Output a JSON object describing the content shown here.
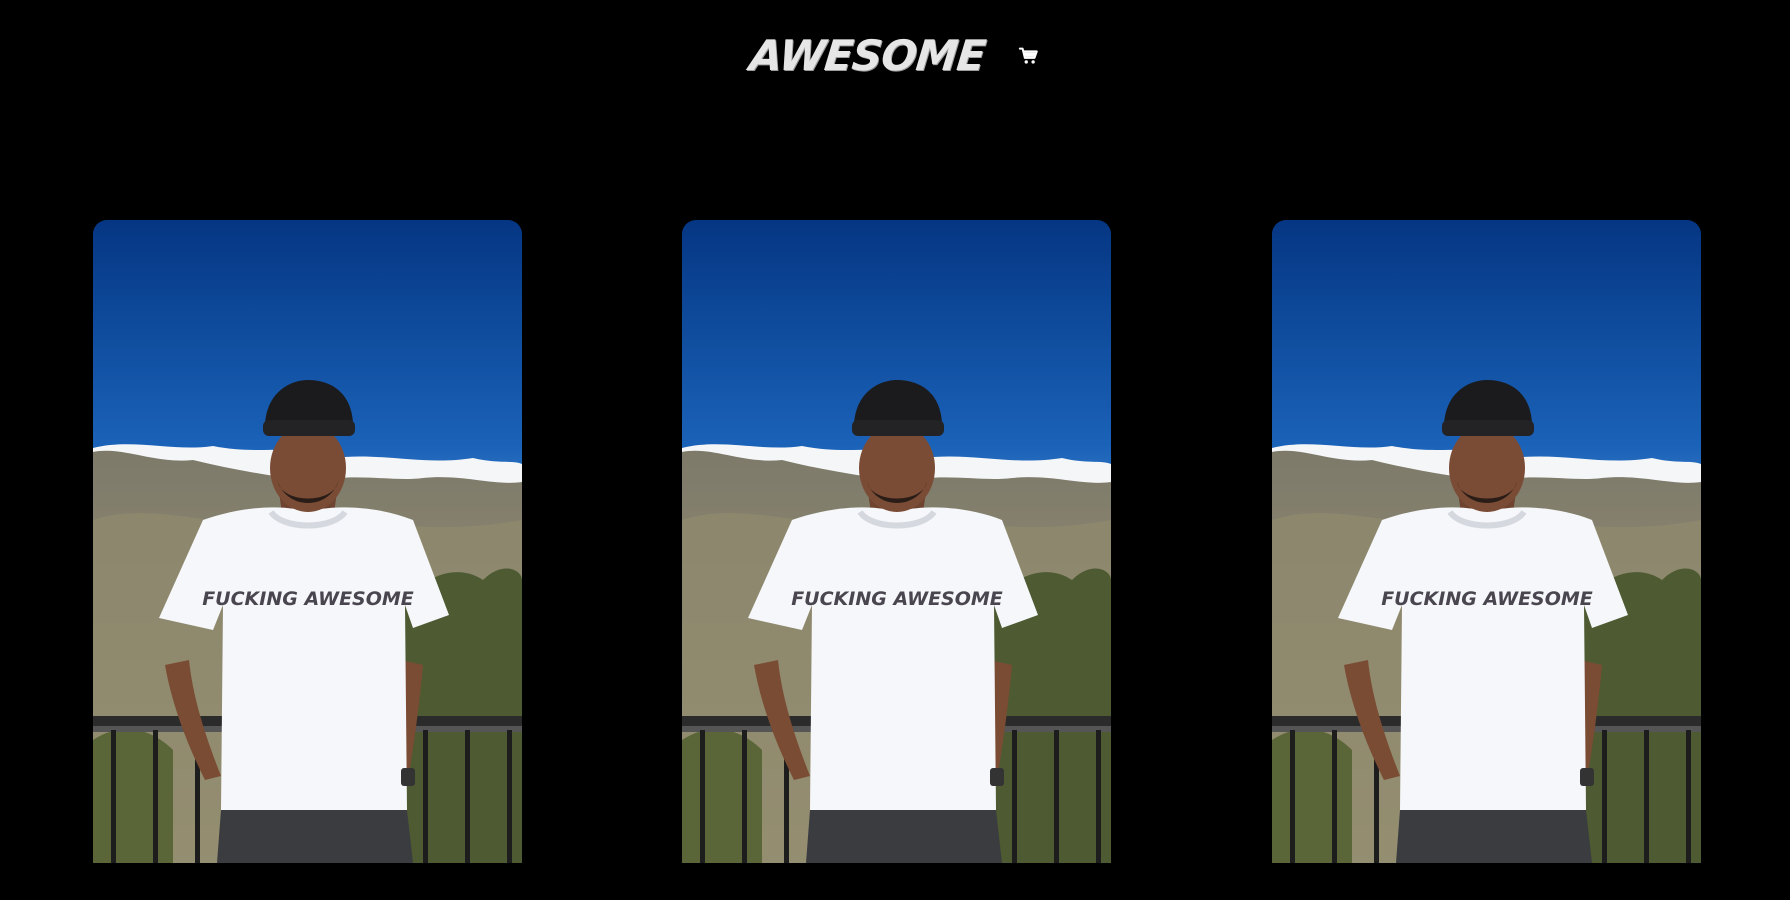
{
  "header": {
    "brand": "AWESOME",
    "cart_icon": "shopping-cart-icon"
  },
  "colors": {
    "background": "#000000",
    "brand_text": "#e6e6e6",
    "sky_top": "#063a86",
    "sky_bottom": "#5a93d4"
  },
  "products": [
    {
      "shirt_print": "FUCKING AWESOME"
    },
    {
      "shirt_print": "FUCKING AWESOME"
    },
    {
      "shirt_print": "FUCKING AWESOME"
    }
  ]
}
